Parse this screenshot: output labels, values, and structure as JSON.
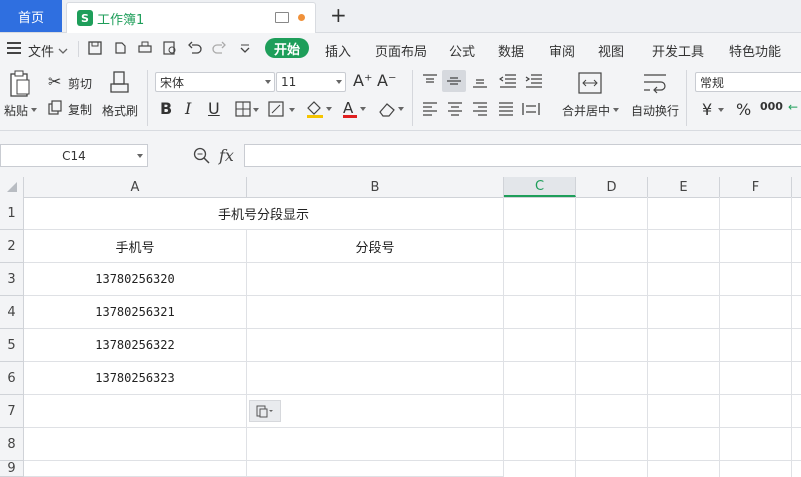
{
  "tabs": {
    "home": "首页",
    "doc_title": "工作簿1",
    "doc_logo": "S",
    "new_tab": "+"
  },
  "menu": {
    "file": "文件",
    "items": [
      "开始",
      "插入",
      "页面布局",
      "公式",
      "数据",
      "审阅",
      "视图",
      "开发工具",
      "特色功能"
    ]
  },
  "ribbon": {
    "paste": "粘贴",
    "cut": "剪切",
    "copy": "复制",
    "format_painter": "格式刷",
    "font_name": "宋体",
    "font_size": "11",
    "merge_center": "合并居中",
    "wrap_text": "自动换行",
    "number_format": "常规",
    "currency_symbol": "¥",
    "percent_symbol": "%",
    "thousands_symbol": "000"
  },
  "formula_bar": {
    "name_box": "C14",
    "fx": "fx",
    "value": ""
  },
  "columns": [
    "A",
    "B",
    "C",
    "D",
    "E",
    "F"
  ],
  "selected_column": "C",
  "rows": [
    "1",
    "2",
    "3",
    "4",
    "5",
    "6",
    "7",
    "8",
    "9"
  ],
  "sheet": {
    "title": "手机号分段显示",
    "header_a": "手机号",
    "header_b": "分段号",
    "phones": [
      "13780256320",
      "13780256321",
      "13780256322",
      "13780256323"
    ]
  },
  "colors": {
    "accent": "#1e9e5a",
    "home_tab": "#2f6fe0",
    "modified_dot": "#f0913a"
  }
}
